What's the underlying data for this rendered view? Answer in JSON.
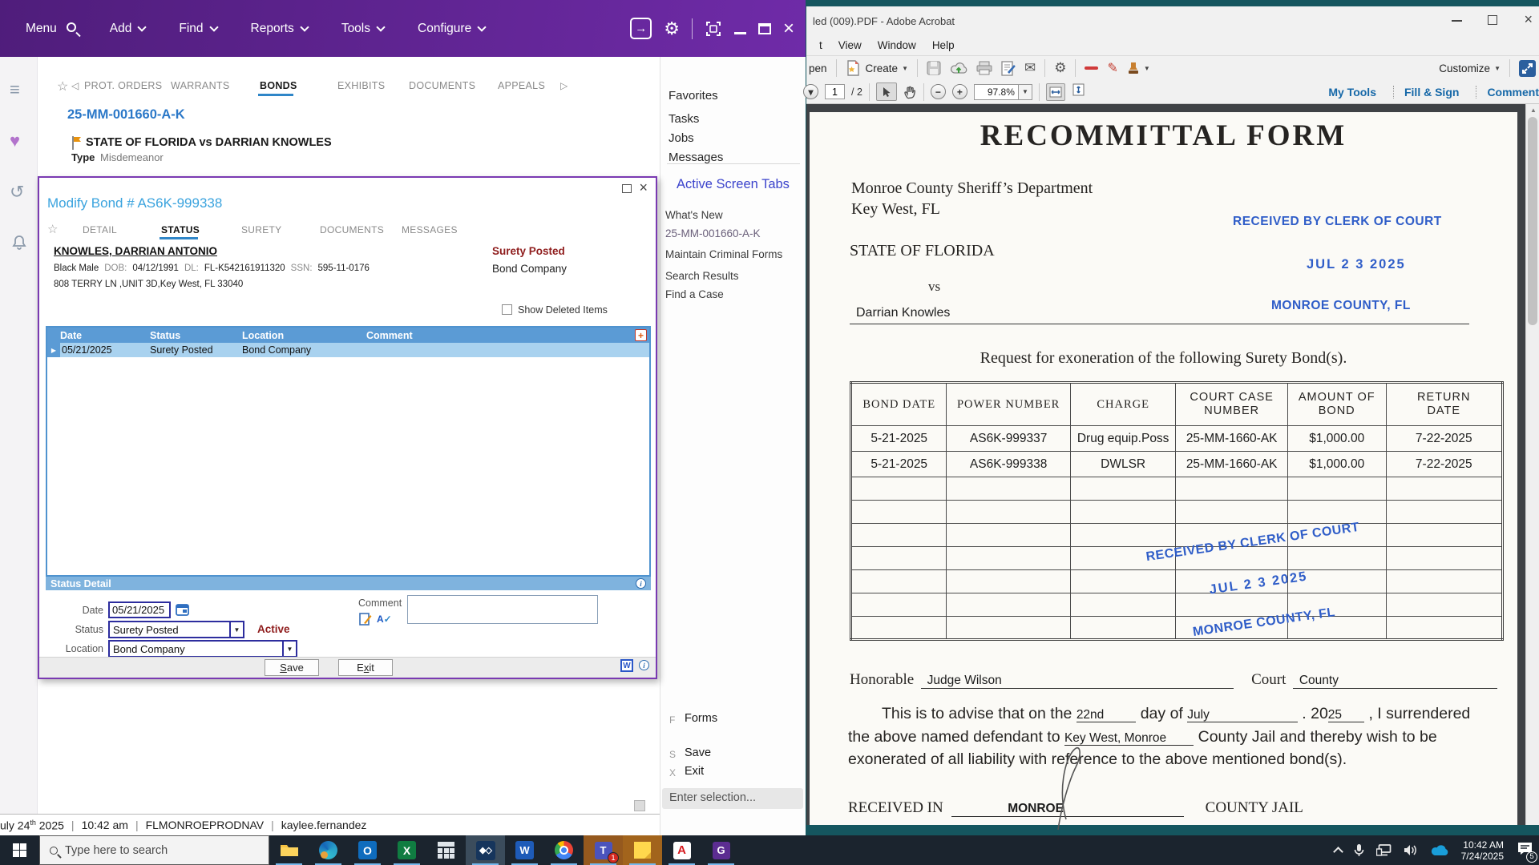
{
  "colors": {
    "accent_purple": "#5f2390",
    "grid_header_blue": "#5b9bd5",
    "row_blue": "#a9d2ef",
    "status_red": "#8f1d1d",
    "link_blue": "#3aa3de",
    "stamp_blue": "#2f5dc8",
    "acrobat_tab_blue": "#1668a8"
  },
  "app": {
    "menu": {
      "items": [
        "Menu",
        "Add",
        "Find",
        "Reports",
        "Tools",
        "Configure"
      ]
    },
    "case_tabs": [
      "PROT. ORDERS",
      "WARRANTS",
      "BONDS",
      "EXHIBITS",
      "DOCUMENTS",
      "APPEALS"
    ],
    "case": {
      "number": "25-MM-001660-A-K",
      "title": "STATE OF FLORIDA vs DARRIAN KNOWLES",
      "type_label": "Type",
      "type_value": "Misdemeanor"
    },
    "right_panel": {
      "items": [
        "Favorites",
        "Tasks",
        "Jobs",
        "Messages"
      ],
      "active_header": "Active Screen Tabs",
      "screen_tabs": [
        "What's New",
        "25-MM-001660-A-K",
        "Maintain Criminal Forms",
        "Search Results",
        "Find a Case"
      ],
      "shortcuts": [
        {
          "key": "F",
          "label": "Forms"
        },
        {
          "key": "S",
          "label": "Save"
        },
        {
          "key": "X",
          "label": "Exit"
        }
      ],
      "selection_placeholder": "Enter selection..."
    },
    "status_bar": {
      "date_pre": "uly 24",
      "date_sup": "th",
      "date_post": " 2025",
      "time": "10:42 am",
      "env": "FLMONROEPRODNAV",
      "user": "kaylee.fernandez",
      "sep": "|"
    }
  },
  "modal": {
    "title": "Modify Bond # AS6K-999338",
    "tabs": [
      "DETAIL",
      "STATUS",
      "SURETY",
      "DOCUMENTS",
      "MESSAGES"
    ],
    "defendant": {
      "name": "KNOWLES, DARRIAN ANTONIO",
      "race_sex": "Black Male",
      "dob_label": "DOB:",
      "dob": "04/12/1991",
      "dl_label": "DL:",
      "dl": "FL-K542161911320",
      "ssn_label": "SSN:",
      "ssn": "595-11-0176",
      "address": "808 TERRY LN ,UNIT 3D,Key West, FL 33040"
    },
    "summary_status": "Surety Posted",
    "summary_location": "Bond Company",
    "show_deleted": "Show Deleted Items",
    "grid": {
      "h_date": "Date",
      "h_status": "Status",
      "h_location": "Location",
      "h_comment": "Comment",
      "add": "+",
      "row": {
        "marker": "▶",
        "date": "05/21/2025",
        "status": "Surety Posted",
        "location": "Bond Company"
      }
    },
    "detail": {
      "header": "Status Detail",
      "date_label": "Date",
      "date_value": "05/21/2025",
      "status_label": "Status",
      "status_value": "Surety Posted",
      "active": "Active",
      "location_label": "Location",
      "location_value": "Bond Company",
      "comment_label": "Comment"
    },
    "buttons": {
      "save_u": "S",
      "save_rest": "ave",
      "exit_pre": "E",
      "exit_u": "x",
      "exit_rest": "it"
    },
    "word_icon": "W",
    "spell_icon": "A",
    "spell_check": "✓"
  },
  "acrobat": {
    "title": "led (009).PDF - Adobe Acrobat",
    "menu": [
      "t",
      "View",
      "Window",
      "Help"
    ],
    "open_label": "pen",
    "create_label": "Create",
    "customize_label": "Customize",
    "page_value": "1",
    "page_total": "/ 2",
    "zoom_value": "97.8%",
    "right_tabs": [
      "My Tools",
      "Fill & Sign",
      "Comment"
    ]
  },
  "pdf": {
    "title": "RECOMMITTAL FORM",
    "dept1": "Monroe County Sheriff’s Department",
    "dept2": "Key West, FL",
    "state": "STATE OF FLORIDA",
    "vs": "vs",
    "defendant": "Darrian Knowles",
    "stamp": {
      "l1": "RECEIVED BY CLERK OF COURT",
      "l2": "JUL 2 3  2025",
      "l3": "MONROE COUNTY, FL"
    },
    "request": "Request for exoneration of the following Surety Bond(s).",
    "table": {
      "h1": "BOND DATE",
      "h2": "POWER NUMBER",
      "h3": "CHARGE",
      "h4a": "COURT CASE",
      "h4b": "NUMBER",
      "h5a": "AMOUNT OF",
      "h5b": "BOND",
      "h6a": "RETURN",
      "h6b": "DATE",
      "rows": [
        {
          "bond_date": "5-21-2025",
          "power": "AS6K-999337",
          "charge": "Drug equip.Poss",
          "case": "25-MM-1660-AK",
          "amount": "$1,000.00",
          "return": "7-22-2025"
        },
        {
          "bond_date": "5-21-2025",
          "power": "AS6K-999338",
          "charge": "DWLSR",
          "case": "25-MM-1660-AK",
          "amount": "$1,000.00",
          "return": "7-22-2025"
        }
      ]
    },
    "honorable_label": "Honorable",
    "honorable_value": "Judge Wilson",
    "court_label": "Court",
    "court_value": "County",
    "advise": {
      "p1": "This is to advise that on the ",
      "v1": "22nd",
      "p2": " day of ",
      "v2": "July",
      "p3": " . 20",
      "v3": "25",
      "p4": " , I surrendered the above named defendant to ",
      "v4": "Key West, Monroe",
      "p5": " County Jail and thereby wish to be exonerated of all liability with reference to the above mentioned bond(s)."
    },
    "received_label": "RECEIVED IN",
    "received_value": "MONROE",
    "county_jail": "COUNTY JAIL"
  },
  "taskbar": {
    "search_placeholder": "Type here to search",
    "teams_badge": "1",
    "time": "10:42 AM",
    "date": "7/24/2025",
    "notif_badge": "5"
  }
}
